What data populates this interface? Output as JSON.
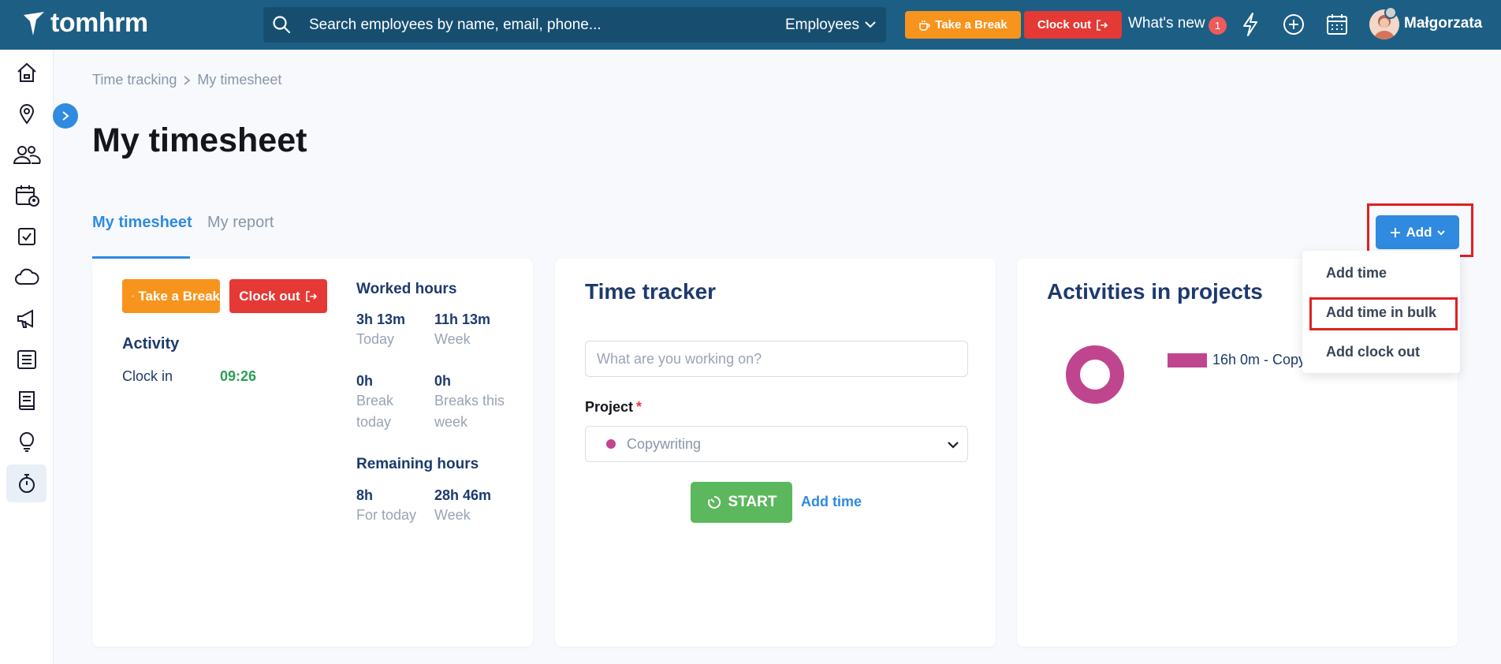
{
  "app": {
    "name": "tomhrm"
  },
  "header": {
    "search_placeholder": "Search employees by name, email, phone...",
    "search_scope": "Employees",
    "take_break": "Take a Break",
    "clock_out": "Clock out",
    "whats_new": "What's new",
    "whats_new_count": "1",
    "user_name": "Małgorzata"
  },
  "breadcrumb": {
    "parent": "Time tracking",
    "current": "My timesheet"
  },
  "page": {
    "title": "My timesheet"
  },
  "tabs": [
    {
      "label": "My timesheet",
      "active": true
    },
    {
      "label": "My report",
      "active": false
    }
  ],
  "add_button": {
    "label": "Add"
  },
  "add_menu": {
    "items": [
      "Add time",
      "Add time in bulk",
      "Add clock out"
    ],
    "highlighted": "Add time in bulk"
  },
  "status_card": {
    "take_break": "Take a Break",
    "clock_out": "Clock out",
    "activity_title": "Activity",
    "clock_in_label": "Clock in",
    "clock_in_time": "09:26",
    "worked_hours_title": "Worked hours",
    "worked_today_value": "3h 13m",
    "worked_today_label": "Today",
    "worked_week_value": "11h 13m",
    "worked_week_label": "Week",
    "break_today_value": "0h",
    "break_today_label": "Break today",
    "breaks_week_value": "0h",
    "breaks_week_label": "Breaks this week",
    "remaining_title": "Remaining hours",
    "remaining_today_value": "8h",
    "remaining_today_label": "For today",
    "remaining_week_value": "28h 46m",
    "remaining_week_label": "Week"
  },
  "time_tracker": {
    "title": "Time tracker",
    "input_placeholder": "What are you working on?",
    "project_label": "Project",
    "required_mark": "*",
    "project_value": "Copywriting",
    "project_color": "#c0458f",
    "start_label": "START",
    "add_time_label": "Add time"
  },
  "activities": {
    "title": "Activities in projects",
    "legend_text": "16h 0m - Copywriting",
    "legend_color": "#c0458f"
  },
  "colors": {
    "topbar": "#1d5e85",
    "primary": "#2f8ae0",
    "orange": "#f7941d",
    "red": "#e53935",
    "green": "#5cb85c",
    "navy": "#1d3a6e"
  },
  "sidebar": {
    "icons": [
      "home-icon",
      "location-icon",
      "people-icon",
      "calendar-person-icon",
      "checklist-icon",
      "cloud-icon",
      "megaphone-icon",
      "news-icon",
      "book-icon",
      "lightbulb-icon",
      "stopwatch-icon"
    ]
  }
}
